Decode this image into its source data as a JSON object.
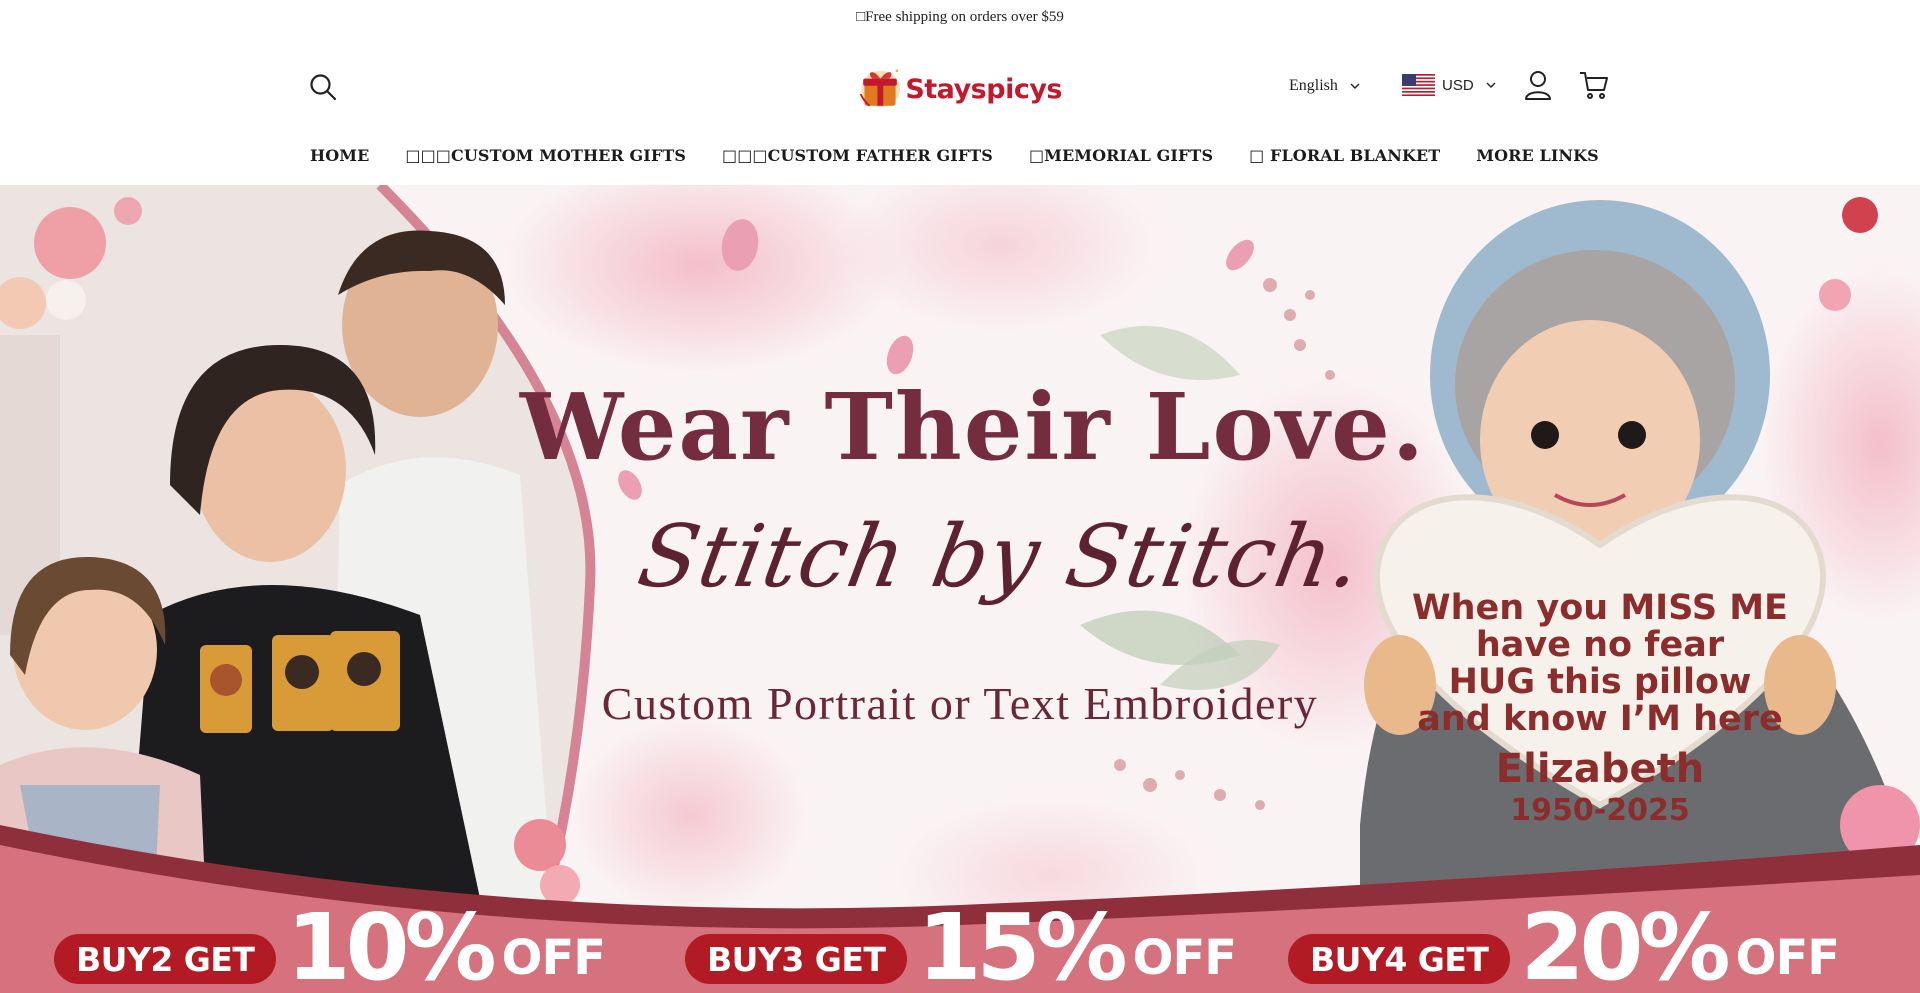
{
  "announcement": {
    "text": "□Free shipping on orders over $59"
  },
  "header": {
    "logo_text": "Stayspicys",
    "language": "English",
    "currency": "USD"
  },
  "nav": {
    "items": [
      {
        "label": "HOME"
      },
      {
        "label": "□□□CUSTOM MOTHER GIFTS"
      },
      {
        "label": "□□□CUSTOM FATHER GIFTS"
      },
      {
        "label": "□MEMORIAL GIFTS"
      },
      {
        "label": "□ FLORAL BLANKET"
      },
      {
        "label": "MORE LINKS"
      }
    ]
  },
  "hero": {
    "headline": "Wear Their Love.",
    "script": "Stitch by Stitch.",
    "subheadline": "Custom Portrait or Text Embroidery",
    "pillow": {
      "lines": [
        "When you MISS ME",
        "have no fear",
        "HUG this pillow",
        "and know I’M here"
      ],
      "name": "Elizabeth",
      "years": "1950-2025"
    }
  },
  "promos": [
    {
      "label": "BUY2 GET",
      "percent": "10%",
      "suffix": "OFF"
    },
    {
      "label": "BUY3 GET",
      "percent": "15%",
      "suffix": "OFF"
    },
    {
      "label": "BUY4 GET",
      "percent": "20%",
      "suffix": "OFF"
    }
  ],
  "colors": {
    "headline": "#742d3f",
    "brand_red": "#c3192c",
    "promo_band": "#d5727d",
    "promo_pill": "#b21b24"
  },
  "icons": {
    "search": "search-icon",
    "account": "user-icon",
    "cart": "cart-icon",
    "language_dropdown": "chevron-down-icon",
    "currency_flag": "us-flag-icon"
  }
}
